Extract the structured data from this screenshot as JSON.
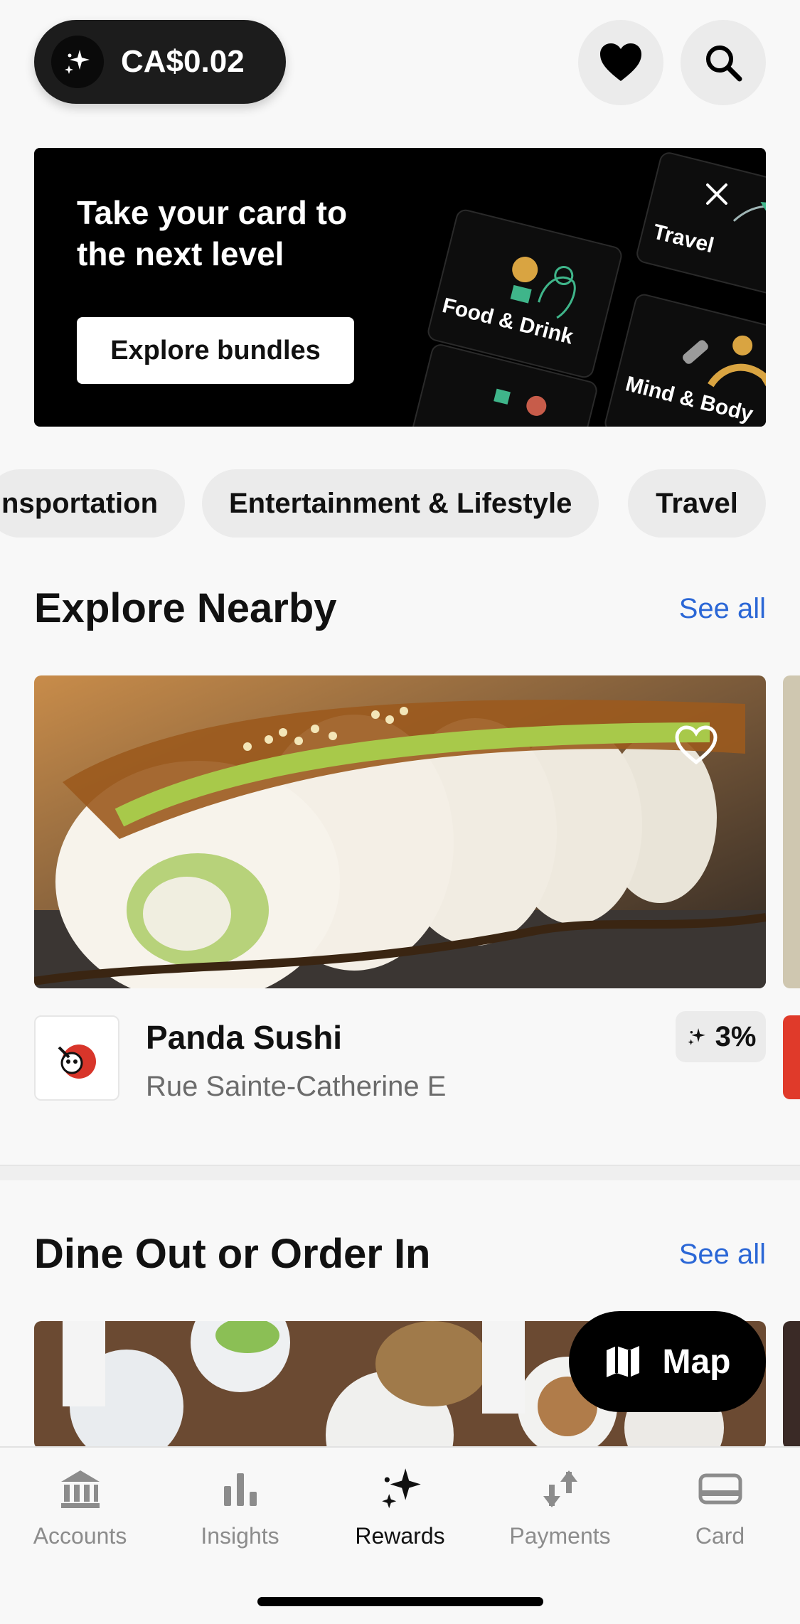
{
  "header": {
    "balance": "CA$0.02",
    "balance_icon": "sparkle-icon",
    "favorites_icon": "heart-icon",
    "search_icon": "search-icon"
  },
  "banner": {
    "title": "Take your card to the next level",
    "button_label": "Explore bundles",
    "close_icon": "close-icon",
    "bundles": [
      "Travel",
      "Food & Drink",
      "Mind & Body"
    ]
  },
  "categories": [
    "nsportation",
    "Entertainment & Lifestyle",
    "Travel"
  ],
  "explore_nearby": {
    "title": "Explore Nearby",
    "see_all": "See all",
    "place": {
      "name": "Panda Sushi",
      "address": "Rue Sainte-Catherine E",
      "cashback": "3%"
    }
  },
  "dine_out": {
    "title": "Dine Out or Order In",
    "see_all": "See all"
  },
  "map_button": {
    "label": "Map",
    "icon": "map-icon"
  },
  "tabbar": {
    "items": [
      {
        "label": "Accounts",
        "icon": "bank-icon"
      },
      {
        "label": "Insights",
        "icon": "bar-chart-icon"
      },
      {
        "label": "Rewards",
        "icon": "sparkle-icon"
      },
      {
        "label": "Payments",
        "icon": "transfer-arrows-icon"
      },
      {
        "label": "Card",
        "icon": "card-icon"
      }
    ],
    "active": "Rewards"
  },
  "colors": {
    "accent_link": "#2b67d6",
    "dark": "#1c1c1c",
    "background": "#f8f8f8"
  }
}
